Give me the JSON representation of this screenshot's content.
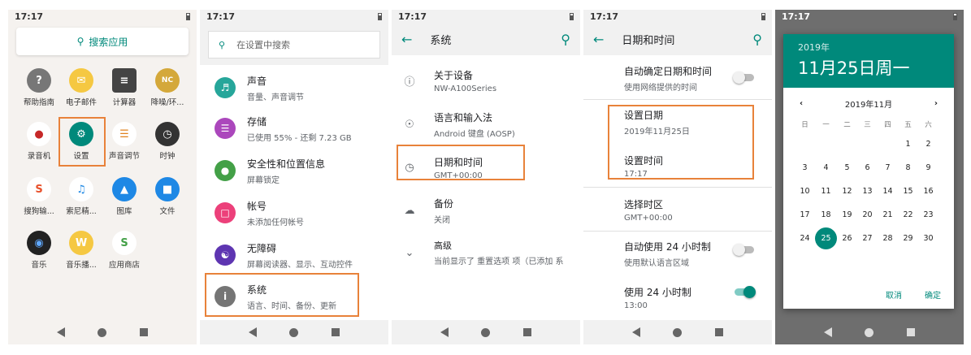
{
  "status_time": "17:17",
  "screen1": {
    "search": "搜索应用",
    "apps": [
      "帮助指南",
      "电子邮件",
      "计算器",
      "降噪/环...",
      "录音机",
      "设置",
      "声音调节",
      "时钟",
      "搜狗输...",
      "索尼精...",
      "图库",
      "文件",
      "音乐",
      "音乐播...",
      "应用商店"
    ]
  },
  "screen2": {
    "search_placeholder": "在设置中搜索",
    "items": [
      {
        "t": "声音",
        "s": "音量、声音调节"
      },
      {
        "t": "存储",
        "s": "已使用 55% - 还剩 7.23 GB"
      },
      {
        "t": "安全性和位置信息",
        "s": "屏幕锁定"
      },
      {
        "t": "帐号",
        "s": "未添加任何帐号"
      },
      {
        "t": "无障碍",
        "s": "屏幕阅读器、显示、互动控件"
      },
      {
        "t": "系统",
        "s": "语言、时间、备份、更新"
      }
    ]
  },
  "screen3": {
    "title": "系统",
    "items": [
      {
        "t": "关于设备",
        "s": "NW-A100Series"
      },
      {
        "t": "语言和输入法",
        "s": "Android 键盘 (AOSP)"
      },
      {
        "t": "日期和时间",
        "s": "GMT+00:00"
      },
      {
        "t": "备份",
        "s": "关闭"
      },
      {
        "t": "高级",
        "s": "当前显示了 重置选项 项（已添加 系"
      }
    ]
  },
  "screen4": {
    "title": "日期和时间",
    "items": [
      {
        "t": "自动确定日期和时间",
        "s": "使用网络提供的时间"
      },
      {
        "t": "设置日期",
        "s": "2019年11月25日"
      },
      {
        "t": "设置时间",
        "s": "17:17"
      },
      {
        "t": "选择时区",
        "s": "GMT+00:00"
      },
      {
        "t": "自动使用 24 小时制",
        "s": "使用默认语言区域"
      },
      {
        "t": "使用 24 小时制",
        "s": "13:00"
      }
    ]
  },
  "screen5": {
    "year": "2019年",
    "date": "11月25日周一",
    "month": "2019年11月",
    "weekdays": [
      "日",
      "一",
      "二",
      "三",
      "四",
      "五",
      "六"
    ],
    "cancel": "取消",
    "ok": "确定",
    "selected": 25
  },
  "colors": {
    "accent": "#00897b",
    "highlight": "#e8823a"
  }
}
